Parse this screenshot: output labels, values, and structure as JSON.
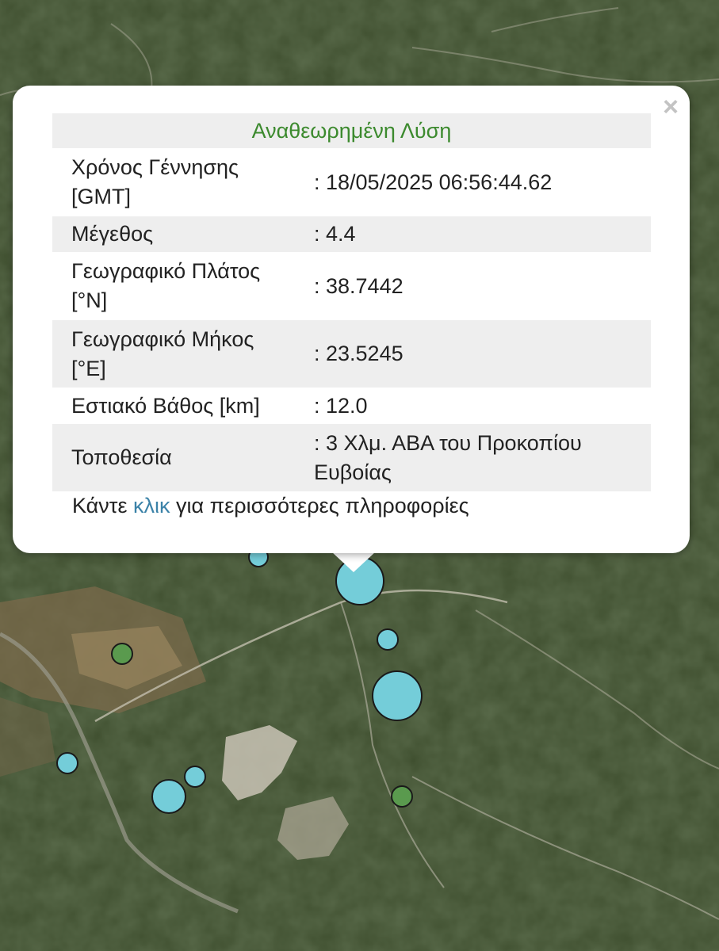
{
  "popup": {
    "title": "Αναθεωρημένη Λύση",
    "close": "×",
    "rows": [
      {
        "label": "Χρόνος Γέννησης [GMT]",
        "value": ": 18/05/2025 06:56:44.62"
      },
      {
        "label": "Μέγεθος",
        "value": ": 4.4"
      },
      {
        "label": "Γεωγραφικό Πλάτος [°N]",
        "value": ": 38.7442"
      },
      {
        "label": "Γεωγραφικό Μήκος [°E]",
        "value": ": 23.5245"
      },
      {
        "label": "Εστιακό Βάθος [km]",
        "value": ": 12.0"
      },
      {
        "label": "Τοποθεσία",
        "value": ": 3 Χλμ. ΑΒΑ του Προκοπίου Ευβοίας"
      }
    ],
    "footer_before": "Κάντε ",
    "footer_link": "κλικ",
    "footer_after": " για περισσότερες πληροφορίες"
  },
  "colors": {
    "marker_cyan": "#74cdd9",
    "marker_green": "#5a9a4e",
    "title_green": "#3c8a2e",
    "link_blue": "#3b82a8"
  }
}
